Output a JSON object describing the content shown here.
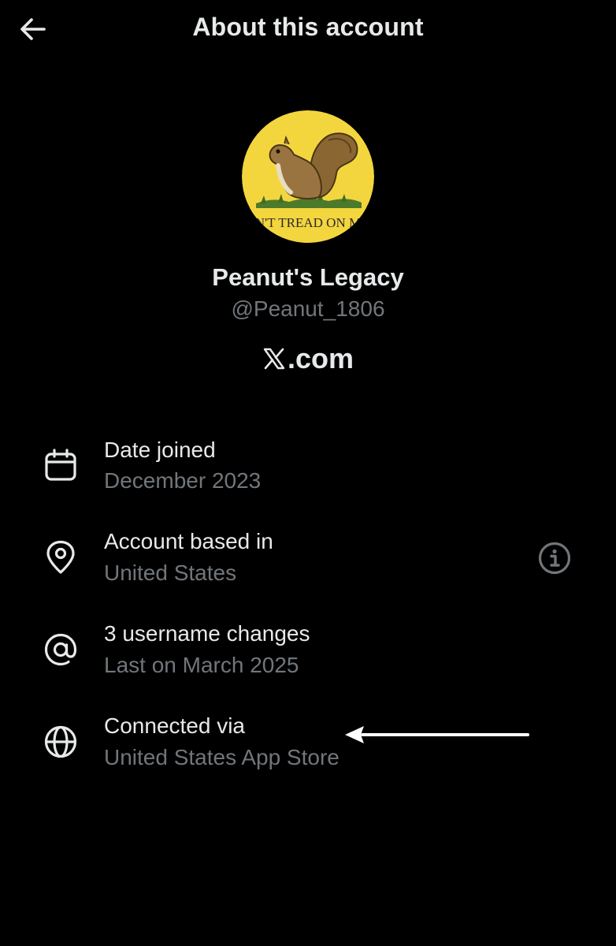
{
  "header": {
    "title": "About this account",
    "back_icon": "arrow-left-icon"
  },
  "profile": {
    "avatar_caption": "N'T TREAD ON M",
    "display_name": "Peanut's Legacy",
    "handle": "@Peanut_1806",
    "platform_suffix": ".com",
    "platform_icon": "x-logo-icon"
  },
  "details": [
    {
      "icon": "calendar-icon",
      "title": "Date joined",
      "subtitle": "December 2023"
    },
    {
      "icon": "location-pin-icon",
      "title": "Account based in",
      "subtitle": "United States",
      "info_icon": "info-icon"
    },
    {
      "icon": "at-sign-icon",
      "title": "3 username changes",
      "subtitle": "Last on March 2025"
    },
    {
      "icon": "globe-icon",
      "title": "Connected via",
      "subtitle": "United States App Store"
    }
  ],
  "annotation": {
    "icon": "arrow-left-annotation"
  },
  "colors": {
    "background": "#000000",
    "primary_text": "#e7e9ea",
    "secondary_text": "#71767b",
    "avatar_background": "#f3d63e",
    "annotation_arrow": "#ffffff"
  }
}
